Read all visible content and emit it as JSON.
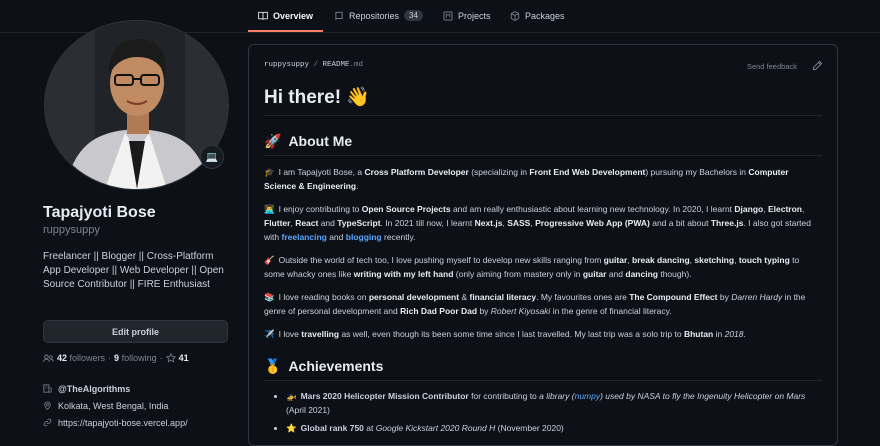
{
  "nav": {
    "tabs": [
      {
        "label": "Overview",
        "icon": "book-icon"
      },
      {
        "label": "Repositories",
        "icon": "repo-icon",
        "count": "34"
      },
      {
        "label": "Projects",
        "icon": "project-icon"
      },
      {
        "label": "Packages",
        "icon": "package-icon"
      }
    ]
  },
  "profile": {
    "status_emoji": "💻",
    "name": "Tapajyoti Bose",
    "login": "ruppysuppy",
    "bio": "Freelancer || Blogger || Cross-Platform App Developer || Web Developer || Open Source Contributor || FIRE Enthusiast",
    "edit_label": "Edit profile",
    "followers_count": "42",
    "followers_label": "followers",
    "sep": "·",
    "following_count": "9",
    "following_label": "following",
    "sep2": "·",
    "stars_count": "41",
    "org": "@TheAlgorithms",
    "location": "Kolkata, West Bengal, India",
    "website": "https://tapajyoti-bose.vercel.app/"
  },
  "readme": {
    "user": "ruppysuppy",
    "slash": " / ",
    "file": "README",
    "ext": ".md",
    "feedback": "Send feedback",
    "title": "Hi there! 👋",
    "about_emoji": "🚀",
    "about_heading": "About Me",
    "about": {
      "p1": {
        "emoji": "🎓",
        "t1": "I am Tapajyoti Bose, a ",
        "b1": "Cross Platform Developer",
        "t2": " (specializing in ",
        "b2": "Front End Web Development",
        "t3": ") pursuing my Bachelors in ",
        "b3": "Computer Science & Engineering",
        "t4": "."
      },
      "p2": {
        "emoji": "👨‍💻",
        "t1": "I enjoy contributing to ",
        "b1": "Open Source Projects",
        "t2": " and am really enthusiastic about learning new technology. In 2020, I learnt ",
        "b2": "Django",
        "t3": ", ",
        "b3": "Electron",
        "t4": ", ",
        "b4": "Flutter",
        "t5": ", ",
        "b5": "React",
        "t6": " and ",
        "b6": "TypeScript",
        "t7": ". In 2021 till now, I learnt ",
        "b7": "Next.js",
        "t8": ", ",
        "b8": "SASS",
        "t9": ", ",
        "b9": "Progressive Web App (PWA)",
        "t10": " and a bit about ",
        "b10": "Three.js",
        "t11": ". I also got started with ",
        "l1": "freelancing",
        "t12": " and ",
        "l2": "blogging",
        "t13": " recently."
      },
      "p3": {
        "emoji": "🎸",
        "t1": "Outside the world of tech too, I love pushing myself to develop new skills ranging from ",
        "b1": "guitar",
        "t2": ", ",
        "b2": "break dancing",
        "t3": ", ",
        "b3": "sketching",
        "t4": ", ",
        "b4": "touch typing",
        "t5": " to some whacky ones like ",
        "b5": "writing with my left hand",
        "t6": " (only aiming from mastery only in ",
        "b6": "guitar",
        "t7": " and ",
        "b7": "dancing",
        "t8": " though)."
      },
      "p4": {
        "emoji": "📚",
        "t1": "I love reading books on ",
        "b1": "personal development",
        "t2": " & ",
        "b2": "financial literacy",
        "t3": ". My favourites ones are ",
        "b3": "The Compound Effect",
        "t4": " by ",
        "i1": "Darren Hardy",
        "t5": " in the genre of personal development and ",
        "b4": "Rich Dad Poor Dad",
        "t6": " by ",
        "i2": "Robert Kiyosaki",
        "t7": " in the genre of financial literacy."
      },
      "p5": {
        "emoji": "✈️",
        "t1": "I love ",
        "b1": "travelling",
        "t2": " as well, even though its been some time since I last travelled. My last trip was a solo trip to ",
        "b2": "Bhutan",
        "t3": " in ",
        "i1": "2018",
        "t4": "."
      }
    },
    "ach_emoji": "🥇",
    "ach_heading": "Achievements",
    "achievements": {
      "a1": {
        "emoji": "🚁",
        "b1": "Mars 2020 Helicopter Mission Contributor",
        "t1": " for contributing to ",
        "i1": "a library (",
        "l1": "numpy",
        "i2": ") used by NASA to fly the Ingenuity Helicopter on Mars",
        "t2": " (April 2021)"
      },
      "a2": {
        "emoji": "⭐",
        "b1": "Global rank 750",
        "t1": " at ",
        "i1": "Google Kickstart 2020 Round H",
        "t2": " (November 2020)"
      }
    }
  },
  "colors": {
    "bg": "#0d1117",
    "accent": "#f78166",
    "link": "#58a6ff",
    "border": "#30363d"
  }
}
